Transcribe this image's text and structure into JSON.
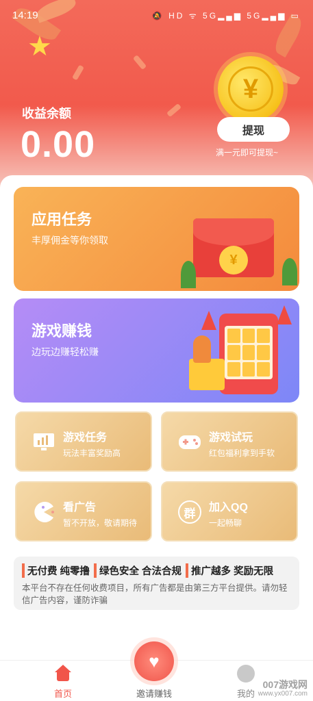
{
  "status_bar": {
    "time": "14:19",
    "icons": "🔕 HD ᯤ 5G▂▄▆ 5G▂▄▆ ▭"
  },
  "header": {
    "balance_label": "收益余额",
    "balance_value": "0.00",
    "coin_symbol": "¥",
    "withdraw_button": "提现",
    "withdraw_hint": "满一元即可提现~"
  },
  "cards": {
    "app_task": {
      "title": "应用任务",
      "subtitle": "丰厚佣金等你领取",
      "coin_symbol": "¥"
    },
    "game_earn": {
      "title": "游戏赚钱",
      "subtitle": "边玩边赚轻松赚"
    }
  },
  "grid": [
    {
      "title": "游戏任务",
      "subtitle": "玩法丰富奖励高",
      "icon": "monitor-chart-icon"
    },
    {
      "title": "游戏试玩",
      "subtitle": "红包福利拿到手软",
      "icon": "gamepad-icon"
    },
    {
      "title": "看广告",
      "subtitle": "暂不开放，敬请期待",
      "icon": "pacman-icon"
    },
    {
      "title": "加入QQ",
      "subtitle": "一起畅聊",
      "icon": "group-chat-icon",
      "icon_text": "群"
    }
  ],
  "notice": {
    "tags": [
      "无付费 纯零撸",
      "绿色安全 合法合规",
      "推广越多 奖励无限"
    ],
    "text": "本平台不存在任何收费项目，所有广告都是由第三方平台提供。请勿轻信广告内容，谨防诈骗"
  },
  "bottom_nav": {
    "home": "首页",
    "invite": "邀请赚钱",
    "mine": "我的"
  },
  "watermark": {
    "main": "007游戏网",
    "sub": "www.yx007.com"
  },
  "colors": {
    "accent": "#f1554a",
    "header_red": "#f25a4c",
    "orange_card": "#f48a3c",
    "purple_card": "#7d87f7",
    "gold_card": "#e9bb78"
  }
}
